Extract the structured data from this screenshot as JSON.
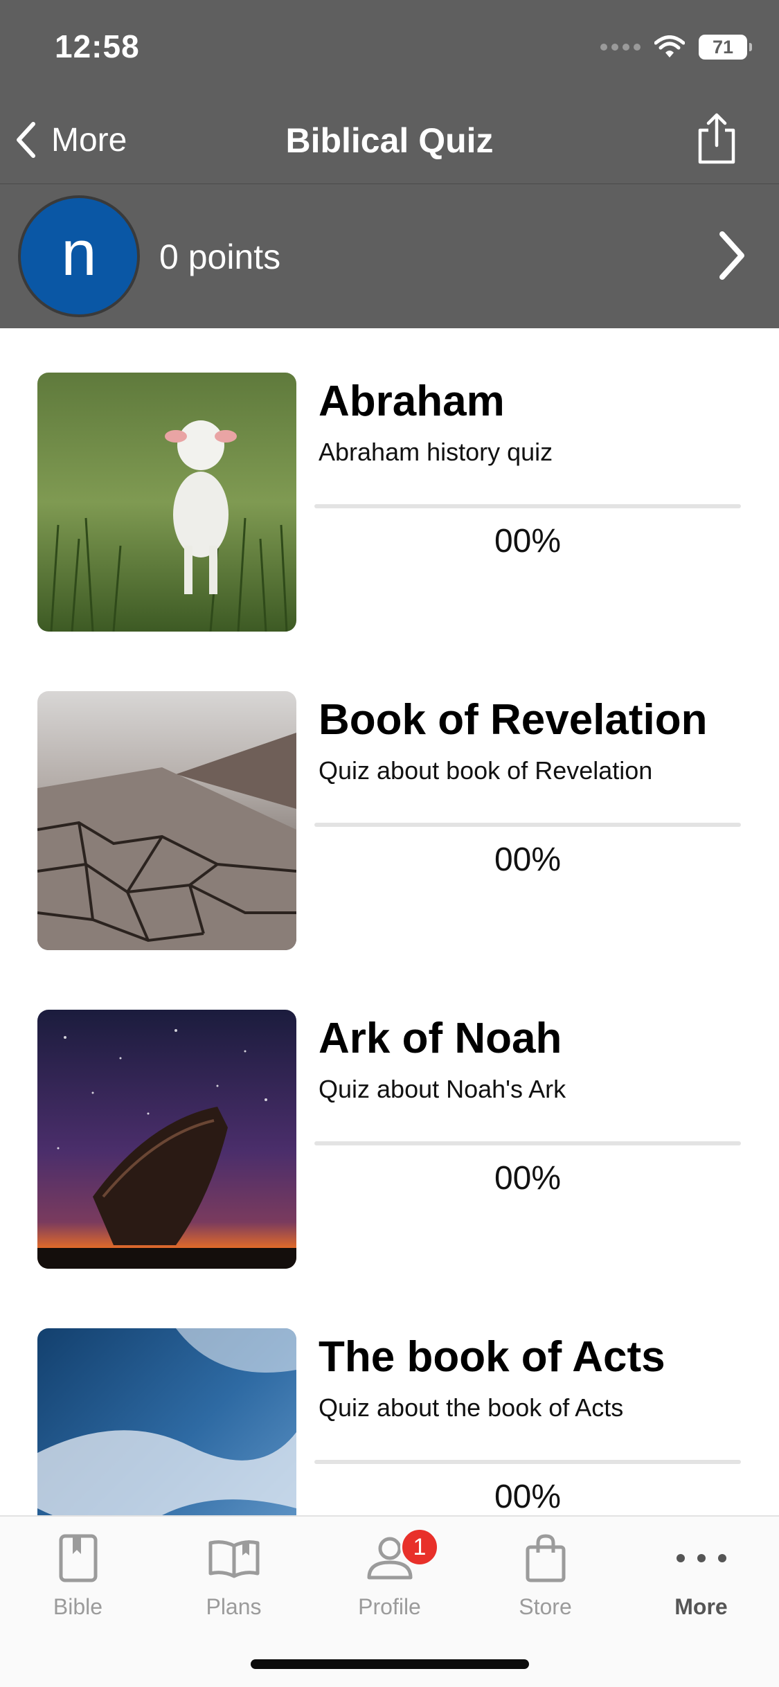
{
  "status": {
    "time": "12:58",
    "battery": "71"
  },
  "nav": {
    "back_label": "More",
    "title": "Biblical Quiz"
  },
  "user": {
    "avatar_letter": "n",
    "points_label": "0 points"
  },
  "quizzes": [
    {
      "title": "Abraham",
      "subtitle": "Abraham history quiz",
      "percent_label": "00%",
      "progress": 0,
      "image": "lamb-in-grass"
    },
    {
      "title": "Book of Revelation",
      "subtitle": "Quiz about book of Revelation",
      "percent_label": "00%",
      "progress": 0,
      "image": "cracked-earth"
    },
    {
      "title": "Ark of Noah",
      "subtitle": "Quiz about Noah's Ark",
      "percent_label": "00%",
      "progress": 0,
      "image": "wooden-boat-night-sky"
    },
    {
      "title": "The book of Acts",
      "subtitle": "Quiz about the book of Acts",
      "percent_label": "00%",
      "progress": 0,
      "image": "cloudy-blue-sky"
    }
  ],
  "tabs": [
    {
      "label": "Bible",
      "icon": "book-icon"
    },
    {
      "label": "Plans",
      "icon": "open-book-icon"
    },
    {
      "label": "Profile",
      "icon": "person-icon",
      "badge": "1"
    },
    {
      "label": "Store",
      "icon": "shopping-bag-icon"
    },
    {
      "label": "More",
      "icon": "ellipsis-icon",
      "active": true
    }
  ],
  "colors": {
    "header_bg": "#5f5f5f",
    "avatar_bg": "#0a57a5",
    "badge": "#e8302a",
    "tab_inactive": "#9b9b9b",
    "tab_active": "#555555"
  }
}
